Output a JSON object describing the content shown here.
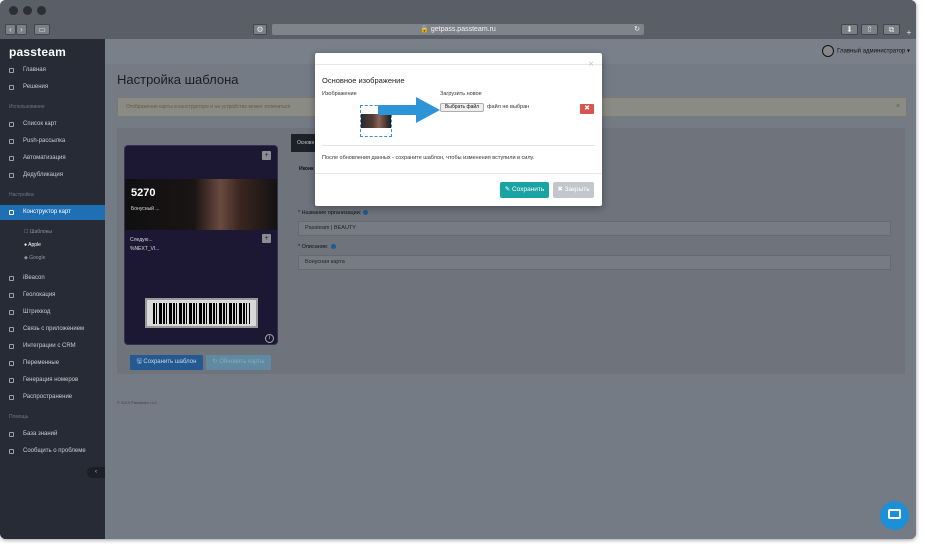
{
  "browser": {
    "url": "getpass.passteam.ru",
    "back_glyph": "‹",
    "forward_glyph": "›",
    "sidebar_glyph": "▭",
    "settings_glyph": "⚙",
    "reload_glyph": "↻",
    "download_glyph": "⬇",
    "share_glyph": "⇧",
    "tabs_glyph": "⧉",
    "new_tab_glyph": "+"
  },
  "sidebar": {
    "logo": "passteam",
    "items_top": [
      {
        "label": "Главная",
        "icon": "home-icon"
      },
      {
        "label": "Решения",
        "icon": "grid-icon"
      }
    ],
    "section_usage": "Использование",
    "items_usage": [
      {
        "label": "Список карт",
        "icon": "list-icon"
      },
      {
        "label": "Push-рассылка",
        "icon": "push-icon"
      },
      {
        "label": "Автоматизация",
        "icon": "automation-icon"
      },
      {
        "label": "Дедубликация",
        "icon": "dedup-icon"
      }
    ],
    "section_settings": "Настройка",
    "active_item": {
      "label": "Конструктор карт",
      "icon": "wrench-icon"
    },
    "sub_items": [
      {
        "label": "☐ Шаблоны"
      },
      {
        "label": "● Apple"
      },
      {
        "label": "◆ Google"
      }
    ],
    "items_settings": [
      {
        "label": "iBeacon",
        "icon": "beacon-icon"
      },
      {
        "label": "Геолокация",
        "icon": "location-icon"
      },
      {
        "label": "Штрихкод",
        "icon": "barcode-icon"
      },
      {
        "label": "Связь с приложением",
        "icon": "link-icon"
      },
      {
        "label": "Интеграции с CRM",
        "icon": "crm-icon"
      },
      {
        "label": "Переменные",
        "icon": "variables-icon"
      },
      {
        "label": "Генерация номеров",
        "icon": "number-icon"
      },
      {
        "label": "Распространение",
        "icon": "distribution-icon"
      }
    ],
    "section_help": "Помощь",
    "items_help": [
      {
        "label": "База знаний",
        "icon": "book-icon"
      },
      {
        "label": "Сообщить о проблеме",
        "icon": "bug-icon"
      }
    ],
    "collapse_glyph": "‹"
  },
  "header": {
    "user_name": "Главный администратор ▾"
  },
  "page": {
    "title": "Настройка шаблона",
    "alert_text": "Отображение карты в конструкторе и на устройстве может отличаться",
    "alert_close": "×"
  },
  "card_preview": {
    "number": "5270",
    "subtitle": "Бонусный ...",
    "text1": "Следую...",
    "text2": "%NEXT_VI...",
    "plus": "+",
    "info": "i"
  },
  "actions": {
    "save_template": "🖫 Сохранить шаблон",
    "update_cards": "↻ Обновить карты"
  },
  "form": {
    "tab_active": "Основн",
    "icon_label": "Иконк",
    "org_label": "* Название организации:",
    "org_value": "Passteam | BEAUTY",
    "desc_label": "* Описание:",
    "desc_value": "Бонусная карта"
  },
  "footer": {
    "copyright": "© 2019 Passteam LLC"
  },
  "modal": {
    "title": "Основное изображение",
    "close": "×",
    "image_label": "Изображение",
    "upload_label": "Загрузить новое",
    "file_button": "Выбрать файл",
    "file_status": "файл не выбран",
    "remove": "✖",
    "note": "После обновления данных - сохраните шаблон, чтобы изменения вступили в силу.",
    "save": "✎ Сохранить",
    "close_button": "✖ Закрыть"
  },
  "colors": {
    "accent": "#1f6fb5",
    "save": "#1aa3a3",
    "danger": "#d9534f",
    "arrow": "#2e94d8"
  }
}
